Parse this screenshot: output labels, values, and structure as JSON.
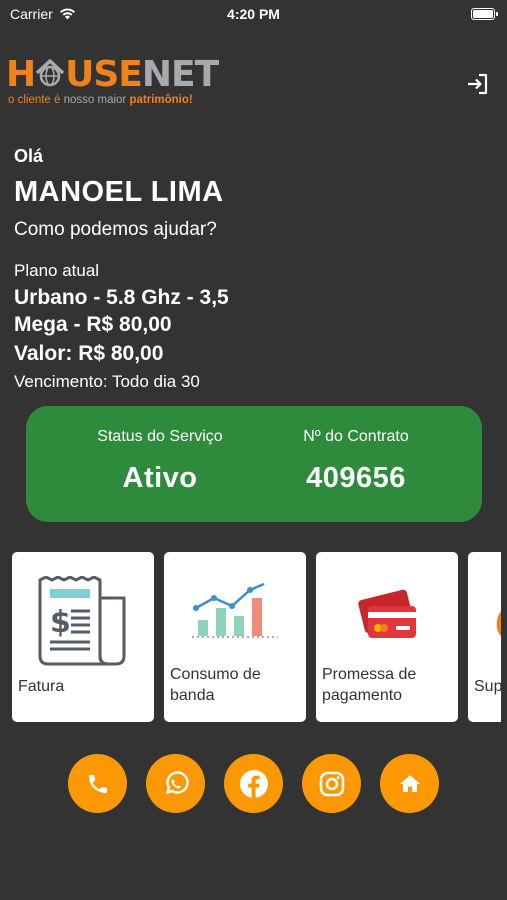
{
  "status_bar": {
    "carrier": "Carrier",
    "time": "4:20 PM"
  },
  "logo": {
    "brand_part1": "H",
    "brand_part2": "USE",
    "brand_part3": "NET",
    "tagline_part1": "o cliente é ",
    "tagline_part2": "nosso maior ",
    "tagline_part3": "patrimônio!"
  },
  "greeting": "Olá",
  "user": {
    "name": "MANOEL LIMA"
  },
  "help_text": "Como podemos ajudar?",
  "plan": {
    "label": "Plano atual",
    "line1": "Urbano - 5.8 Ghz - 3,5",
    "line2": "Mega - R$ 80,00",
    "line3": "Valor: R$ 80,00",
    "due": "Vencimento: Todo dia 30"
  },
  "service": {
    "status_label": "Status do Serviço",
    "status_value": "Ativo",
    "contract_label": "Nº do Contrato",
    "contract_value": "409656"
  },
  "cards": [
    {
      "label": "Fatura",
      "icon": "invoice-icon"
    },
    {
      "label_line1": "Consumo de",
      "label_line2": "banda",
      "icon": "bandwidth-chart-icon"
    },
    {
      "label_line1": "Promessa de",
      "label_line2": "pagamento",
      "icon": "credit-card-icon"
    },
    {
      "label": "Sup",
      "icon": "support-icon"
    }
  ],
  "social": [
    "phone-icon",
    "whatsapp-icon",
    "facebook-icon",
    "instagram-icon",
    "home-icon"
  ],
  "colors": {
    "background": "#333333",
    "accent": "#fb9804",
    "status_green": "#2e8b3b",
    "brand_orange": "#f0821e",
    "brand_grey": "#a7a9ac"
  }
}
